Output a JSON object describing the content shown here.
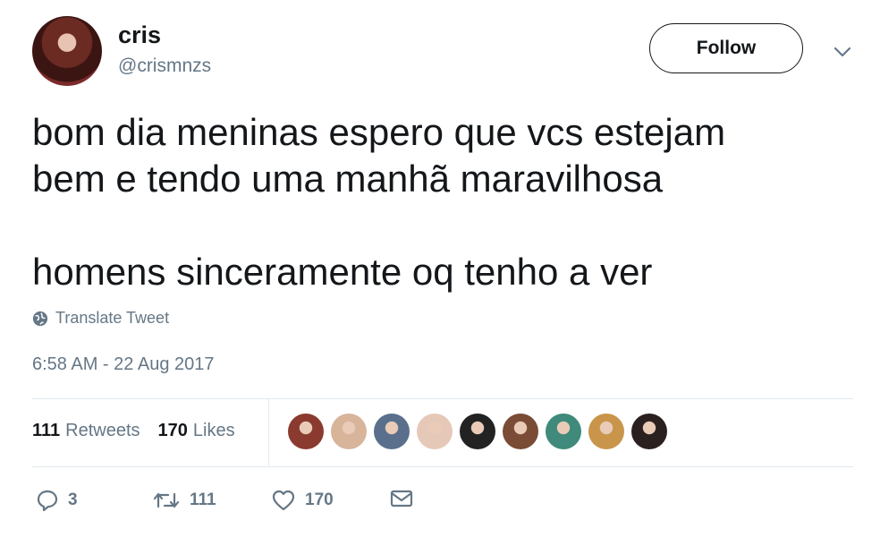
{
  "user": {
    "name": "cris",
    "handle": "@crismnzs",
    "follow_label": "Follow"
  },
  "tweet": {
    "text": "bom dia meninas espero que vcs estejam\nbem e tendo uma manhã maravilhosa\n\nhomens sinceramente oq tenho a ver",
    "translate_label": "Translate Tweet",
    "timestamp": "6:58 AM - 22 Aug 2017"
  },
  "stats": {
    "retweets_count": "111",
    "retweets_label": "Retweets",
    "likes_count": "170",
    "likes_label": "Likes"
  },
  "liker_avatars": [
    {
      "color": "#8a3a2e"
    },
    {
      "color": "#d8b49a"
    },
    {
      "color": "#5a6f8c"
    },
    {
      "color": "#e6c8b8"
    },
    {
      "color": "#222222"
    },
    {
      "color": "#7a4b35"
    },
    {
      "color": "#3f8a7a"
    },
    {
      "color": "#c9954a"
    },
    {
      "color": "#2a2020"
    }
  ],
  "actions": {
    "reply_count": "3",
    "retweet_count": "111",
    "like_count": "170"
  },
  "icons": {
    "reply": "reply-icon",
    "retweet": "retweet-icon",
    "like": "heart-icon",
    "dm": "envelope-icon",
    "caret": "chevron-down-icon",
    "translate": "globe-icon"
  }
}
